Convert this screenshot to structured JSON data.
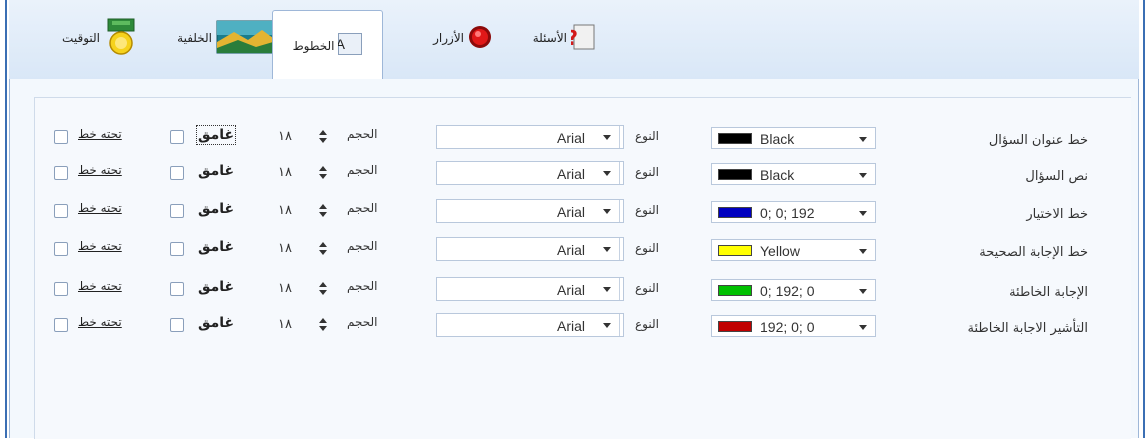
{
  "tabs": [
    {
      "label": "التوقيت",
      "icon": "medal-timer-icon",
      "active": false
    },
    {
      "label": "الخلفية",
      "icon": "landscape-picture-icon",
      "active": false
    },
    {
      "label": "الخطوط",
      "icon": "font-size-icon",
      "active": true
    },
    {
      "label": "الأزرار",
      "icon": "red-button-icon",
      "active": false
    },
    {
      "label": "الأسئلة",
      "icon": "question-mark-icon",
      "active": false
    }
  ],
  "labels": {
    "type": "النوع",
    "size": "الحجم",
    "bold": "غامق",
    "underline": "تحته خط"
  },
  "rows": [
    {
      "label": "خط عنوان السؤال",
      "color_name": "Black",
      "color_hex": "#000000",
      "font": "Arial",
      "size": "١٨"
    },
    {
      "label": "نص السؤال",
      "color_name": "Black",
      "color_hex": "#000000",
      "font": "Arial",
      "size": "١٨"
    },
    {
      "label": "خط الاختيار",
      "color_name": "0; 0; 192",
      "color_hex": "#0000c0",
      "font": "Arial",
      "size": "١٨"
    },
    {
      "label": "خط الإجابة الصحيحة",
      "color_name": "Yellow",
      "color_hex": "#ffff00",
      "font": "Arial",
      "size": "١٨"
    },
    {
      "label": "الإجابة الخاطئة",
      "color_name": "0; 192; 0",
      "color_hex": "#00c000",
      "font": "Arial",
      "size": "١٨"
    },
    {
      "label": "التأشير الاجابة الخاطئة",
      "color_name": "192; 0; 0",
      "color_hex": "#c00000",
      "font": "Arial",
      "size": "١٨"
    }
  ]
}
